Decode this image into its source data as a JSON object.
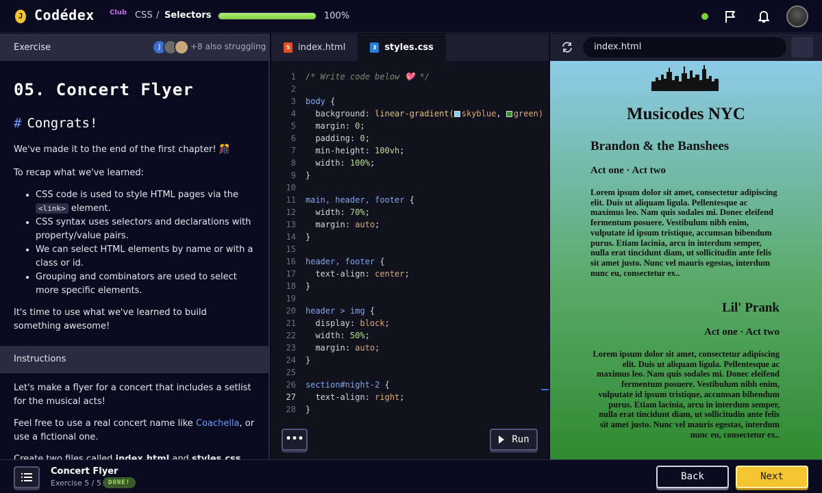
{
  "header": {
    "logo_coin": "J",
    "logo_text": "Codédex",
    "logo_badge": "Club",
    "breadcrumb": [
      "CSS",
      "/",
      "Selectors"
    ],
    "progress_percent": 100,
    "progress_label": "100%",
    "status_color": "#7fd13b",
    "icons": [
      "flag-icon",
      "bell-icon",
      "user-avatar"
    ]
  },
  "left_panel": {
    "header_label": "Exercise",
    "struggle_avatar_initial": "J",
    "struggling_text": "+8 also struggling",
    "lesson_title": "05. Concert Flyer",
    "subheading_hash": "#",
    "subheading": "Congrats!",
    "intro": "We've made it to the end of the first chapter! 🎊",
    "recap_intro": "To recap what we've learned:",
    "bullets": {
      "b1_before": "CSS code is used to style HTML pages via the ",
      "b1_code": "<link>",
      "b1_after": " element.",
      "b2": "CSS syntax uses selectors and declarations with property/value pairs.",
      "b3": "We can select HTML elements by name or with a class or id.",
      "b4": "Grouping and combinators are used to select more specific elements."
    },
    "closing": "It's time to use what we've learned to build something awesome!",
    "instructions_label": "Instructions",
    "instructions": {
      "p1": "Let's make a flyer for a concert that includes a setlist for the musical acts!",
      "p2_before": "Feel free to use a real concert name like ",
      "p2_link": "Coachella",
      "p2_after": ", or use a fictional one.",
      "p3_start": "Create two files called ",
      "p3_file1": "index.html",
      "p3_mid": " and ",
      "p3_file2": "styles.css"
    }
  },
  "editor": {
    "tabs": [
      {
        "label": "index.html",
        "icon": "html5-icon",
        "active": false
      },
      {
        "label": "styles.css",
        "icon": "css3-icon",
        "active": true
      }
    ],
    "more_label": "•••",
    "run_label": "Run",
    "code": {
      "l1": "/* Write code below 💖 */",
      "l3_sel": "body",
      "l4_prop": "background",
      "l4_fn": "linear-gradient(",
      "l4_v1": "skyblue",
      "l4_v2": "green)",
      "l5_prop": "margin",
      "l5_val": "0",
      "l6_prop": "padding",
      "l6_val": "0",
      "l7_prop": "min-height",
      "l7_val": "100vh",
      "l8_prop": "width",
      "l8_val": "100%",
      "l11_sel": "main, header, footer",
      "l12_prop": "width",
      "l12_val": "70%",
      "l13_prop": "margin",
      "l13_val": "auto",
      "l16_sel": "header, footer",
      "l17_prop": "text-align",
      "l17_val": "center",
      "l20_sel": "header > img",
      "l21_prop": "display",
      "l21_val": "block",
      "l22_prop": "width",
      "l22_val": "50%",
      "l23_prop": "margin",
      "l23_val": "auto",
      "l26_sel": "section#night-2",
      "l27_prop": "text-align",
      "l27_val": "right"
    }
  },
  "preview": {
    "url": "index.html",
    "title": "Musicodes NYC",
    "band1": "Brandon & the Banshees",
    "acts1": "Act one · Act two",
    "lorem1": "Lorem ipsum dolor sit amet, consectetur adipiscing elit. Duis ut aliquam ligula. Pellentesque ac maximus leo. Nam quis sodales mi. Donec eleifend fermentum posuere. Vestibulum nibh enim, vulputate id ipsum tristique, accumsan bibendum purus. Etiam lacinia, arcu in interdum semper, nulla erat tincidunt diam, ut sollicitudin ante felis sit amet justo. Nunc vel mauris egestas, interdum nunc eu, consectetur ex..",
    "band2": "Lil' Prank",
    "acts2": "Act one · Act two",
    "lorem2": "Lorem ipsum dolor sit amet, consectetur adipiscing elit. Duis ut aliquam ligula. Pellentesque ac maximus leo. Nam quis sodales mi. Donec eleifend fermentum posuere. Vestibulum nibh enim, vulputate id ipsum tristique, accumsan bibendum purus. Etiam lacinia, arcu in interdum semper, nulla erat tincidunt diam, ut sollicitudin ante felis sit amet justo. Nunc vel mauris egestas, interdum nunc eu, consectetur ex.."
  },
  "footer": {
    "exercise_title": "Concert Flyer",
    "exercise_sub": "Exercise 5 / 5",
    "badge": "DONE!",
    "back_label": "Back",
    "next_label": "Next",
    "next_color": "#f5c531"
  }
}
